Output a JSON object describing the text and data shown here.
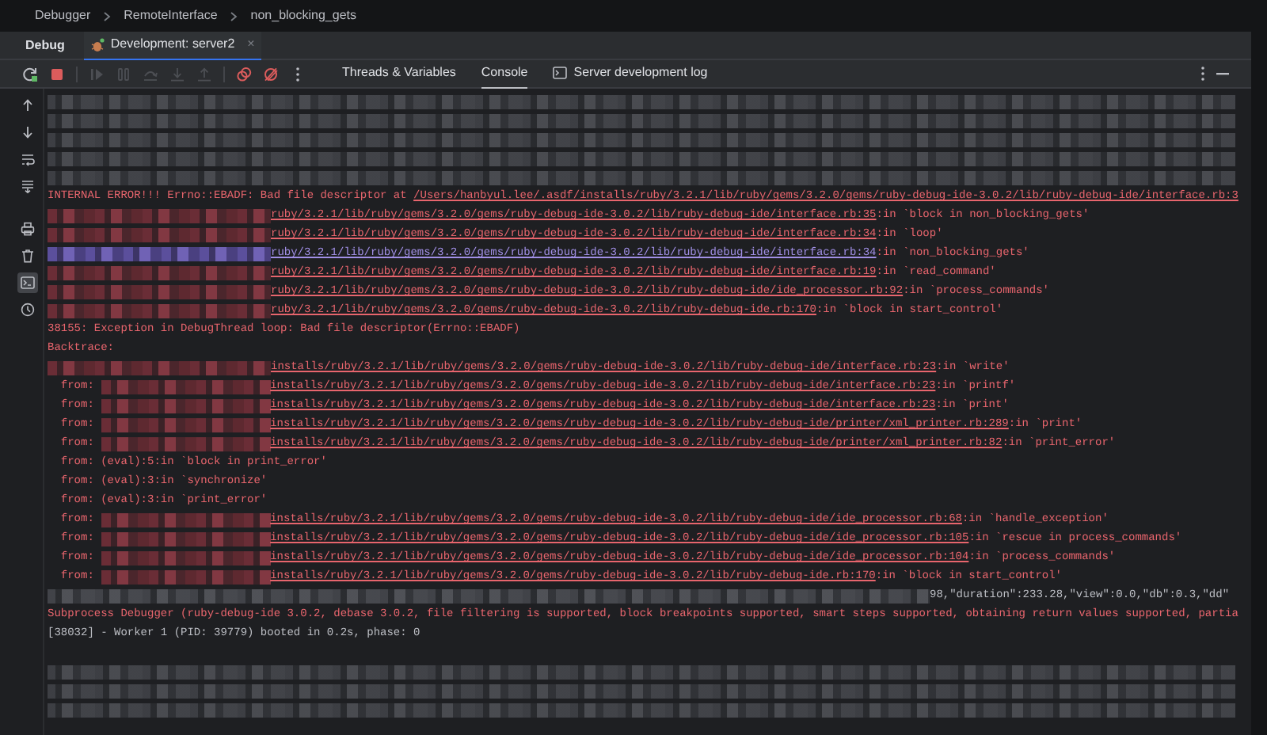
{
  "breadcrumbs": [
    "Debugger",
    "RemoteInterface",
    "non_blocking_gets"
  ],
  "tool_window": {
    "title": "Debug",
    "session_tab": {
      "label": "Development: server2",
      "close": "×",
      "selected": true
    }
  },
  "toolbar": [
    {
      "kind": "rerun",
      "disabled": false
    },
    {
      "kind": "stop",
      "disabled": false
    },
    {
      "kind": "resume",
      "disabled": true
    },
    {
      "kind": "pause",
      "disabled": true
    },
    {
      "kind": "step_over",
      "disabled": true
    },
    {
      "kind": "step_into",
      "disabled": true
    },
    {
      "kind": "step_out",
      "disabled": true
    },
    {
      "kind": "breakpoints",
      "disabled": false
    },
    {
      "kind": "mute",
      "disabled": false
    },
    {
      "kind": "more",
      "disabled": false
    }
  ],
  "tabs": [
    {
      "label": "Threads & Variables",
      "icon": false,
      "selected": false
    },
    {
      "label": "Console",
      "icon": false,
      "selected": true
    },
    {
      "label": "Server development log",
      "icon": true,
      "selected": false
    }
  ],
  "side_toolbar": [
    {
      "kind": "up",
      "selected": false
    },
    {
      "kind": "down",
      "selected": false
    },
    {
      "kind": "wrap",
      "selected": false
    },
    {
      "kind": "scroll_end",
      "selected": false
    },
    {
      "kind": "print",
      "selected": false
    },
    {
      "kind": "trash",
      "selected": false
    },
    {
      "kind": "terminal",
      "selected": true
    },
    {
      "kind": "clock",
      "selected": false
    }
  ],
  "console": {
    "lines": [
      {
        "kind": "blurred"
      },
      {
        "kind": "blurred"
      },
      {
        "kind": "blurred"
      },
      {
        "kind": "blurred"
      },
      {
        "kind": "blurred"
      },
      {
        "kind": "error_path",
        "text": "INTERNAL ERROR!!! Errno::EBADF: Bad file descriptor at ",
        "path": "/Users/hanbyul.lee/.asdf/installs/ruby/3.2.1/lib/ruby/gems/3.2.0/gems/ruby-debug-ide-3.0.2/lib/ruby-debug-ide/interface.rb:3"
      },
      {
        "kind": "trace",
        "path": "ruby/3.2.1/lib/ruby/gems/3.2.0/gems/ruby-debug-ide-3.0.2/lib/ruby-debug-ide/interface.rb:35",
        "suffix": ":in `block in non_blocking_gets'",
        "highlighted": false
      },
      {
        "kind": "trace",
        "path": "ruby/3.2.1/lib/ruby/gems/3.2.0/gems/ruby-debug-ide-3.0.2/lib/ruby-debug-ide/interface.rb:34",
        "suffix": ":in `loop'",
        "highlighted": false
      },
      {
        "kind": "trace",
        "path": "ruby/3.2.1/lib/ruby/gems/3.2.0/gems/ruby-debug-ide-3.0.2/lib/ruby-debug-ide/interface.rb:34",
        "suffix": ":in `non_blocking_gets'",
        "highlighted": true
      },
      {
        "kind": "trace",
        "path": "ruby/3.2.1/lib/ruby/gems/3.2.0/gems/ruby-debug-ide-3.0.2/lib/ruby-debug-ide/interface.rb:19",
        "suffix": ":in `read_command'",
        "highlighted": false
      },
      {
        "kind": "trace",
        "path": "ruby/3.2.1/lib/ruby/gems/3.2.0/gems/ruby-debug-ide-3.0.2/lib/ruby-debug-ide/ide_processor.rb:92",
        "suffix": ":in `process_commands'",
        "highlighted": false
      },
      {
        "kind": "trace",
        "path": "ruby/3.2.1/lib/ruby/gems/3.2.0/gems/ruby-debug-ide-3.0.2/lib/ruby-debug-ide.rb:170",
        "suffix": ":in `block in start_control'",
        "highlighted": false
      },
      {
        "kind": "text",
        "error": true,
        "text": "38155: Exception in DebugThread loop: Bad file descriptor(Errno::EBADF)"
      },
      {
        "kind": "text",
        "error": true,
        "text": "Backtrace:"
      },
      {
        "kind": "trace",
        "path": "installs/ruby/3.2.1/lib/ruby/gems/3.2.0/gems/ruby-debug-ide-3.0.2/lib/ruby-debug-ide/interface.rb:23",
        "suffix": ":in `write'",
        "highlighted": false
      },
      {
        "kind": "from_trace",
        "prefix": "  from: ",
        "path": "installs/ruby/3.2.1/lib/ruby/gems/3.2.0/gems/ruby-debug-ide-3.0.2/lib/ruby-debug-ide/interface.rb:23",
        "suffix": ":in `printf'",
        "highlighted": false
      },
      {
        "kind": "from_trace",
        "prefix": "  from: ",
        "path": "installs/ruby/3.2.1/lib/ruby/gems/3.2.0/gems/ruby-debug-ide-3.0.2/lib/ruby-debug-ide/interface.rb:23",
        "suffix": ":in `print'",
        "highlighted": false
      },
      {
        "kind": "from_trace",
        "prefix": "  from: ",
        "path": "installs/ruby/3.2.1/lib/ruby/gems/3.2.0/gems/ruby-debug-ide-3.0.2/lib/ruby-debug-ide/printer/xml_printer.rb:289",
        "suffix": ":in `print'",
        "highlighted": false
      },
      {
        "kind": "from_trace",
        "prefix": "  from: ",
        "path": "installs/ruby/3.2.1/lib/ruby/gems/3.2.0/gems/ruby-debug-ide-3.0.2/lib/ruby-debug-ide/printer/xml_printer.rb:82",
        "suffix": ":in `print_error'",
        "highlighted": false
      },
      {
        "kind": "text",
        "error": true,
        "text": "  from: (eval):5:in `block in print_error'"
      },
      {
        "kind": "text",
        "error": true,
        "text": "  from: (eval):3:in `synchronize'"
      },
      {
        "kind": "text",
        "error": true,
        "text": "  from: (eval):3:in `print_error'"
      },
      {
        "kind": "from_trace",
        "prefix": "  from: ",
        "path": "installs/ruby/3.2.1/lib/ruby/gems/3.2.0/gems/ruby-debug-ide-3.0.2/lib/ruby-debug-ide/ide_processor.rb:68",
        "suffix": ":in `handle_exception'",
        "highlighted": false
      },
      {
        "kind": "from_trace",
        "prefix": "  from: ",
        "path": "installs/ruby/3.2.1/lib/ruby/gems/3.2.0/gems/ruby-debug-ide-3.0.2/lib/ruby-debug-ide/ide_processor.rb:105",
        "suffix": ":in `rescue in process_commands'",
        "highlighted": false
      },
      {
        "kind": "from_trace",
        "prefix": "  from: ",
        "path": "installs/ruby/3.2.1/lib/ruby/gems/3.2.0/gems/ruby-debug-ide-3.0.2/lib/ruby-debug-ide/ide_processor.rb:104",
        "suffix": ":in `process_commands'",
        "highlighted": false
      },
      {
        "kind": "from_trace",
        "prefix": "  from: ",
        "path": "installs/ruby/3.2.1/lib/ruby/gems/3.2.0/gems/ruby-debug-ide-3.0.2/lib/ruby-debug-ide.rb:170",
        "suffix": ":in `block in start_control'",
        "highlighted": false
      },
      {
        "kind": "redacted_text",
        "text": "98,\"duration\":233.28,\"view\":0.0,\"db\":0.3,\"dd\""
      },
      {
        "kind": "text",
        "error": true,
        "text": "Subprocess Debugger (ruby-debug-ide 3.0.2, debase 3.0.2, file filtering is supported, block breakpoints supported, smart steps supported, obtaining return values supported, partia"
      },
      {
        "kind": "text",
        "error": false,
        "text": "[38032] - Worker 1 (PID: 39779) booted in 0.2s, phase: 0"
      },
      {
        "kind": "blank"
      },
      {
        "kind": "blurred"
      },
      {
        "kind": "blurred"
      },
      {
        "kind": "blurred"
      }
    ]
  }
}
